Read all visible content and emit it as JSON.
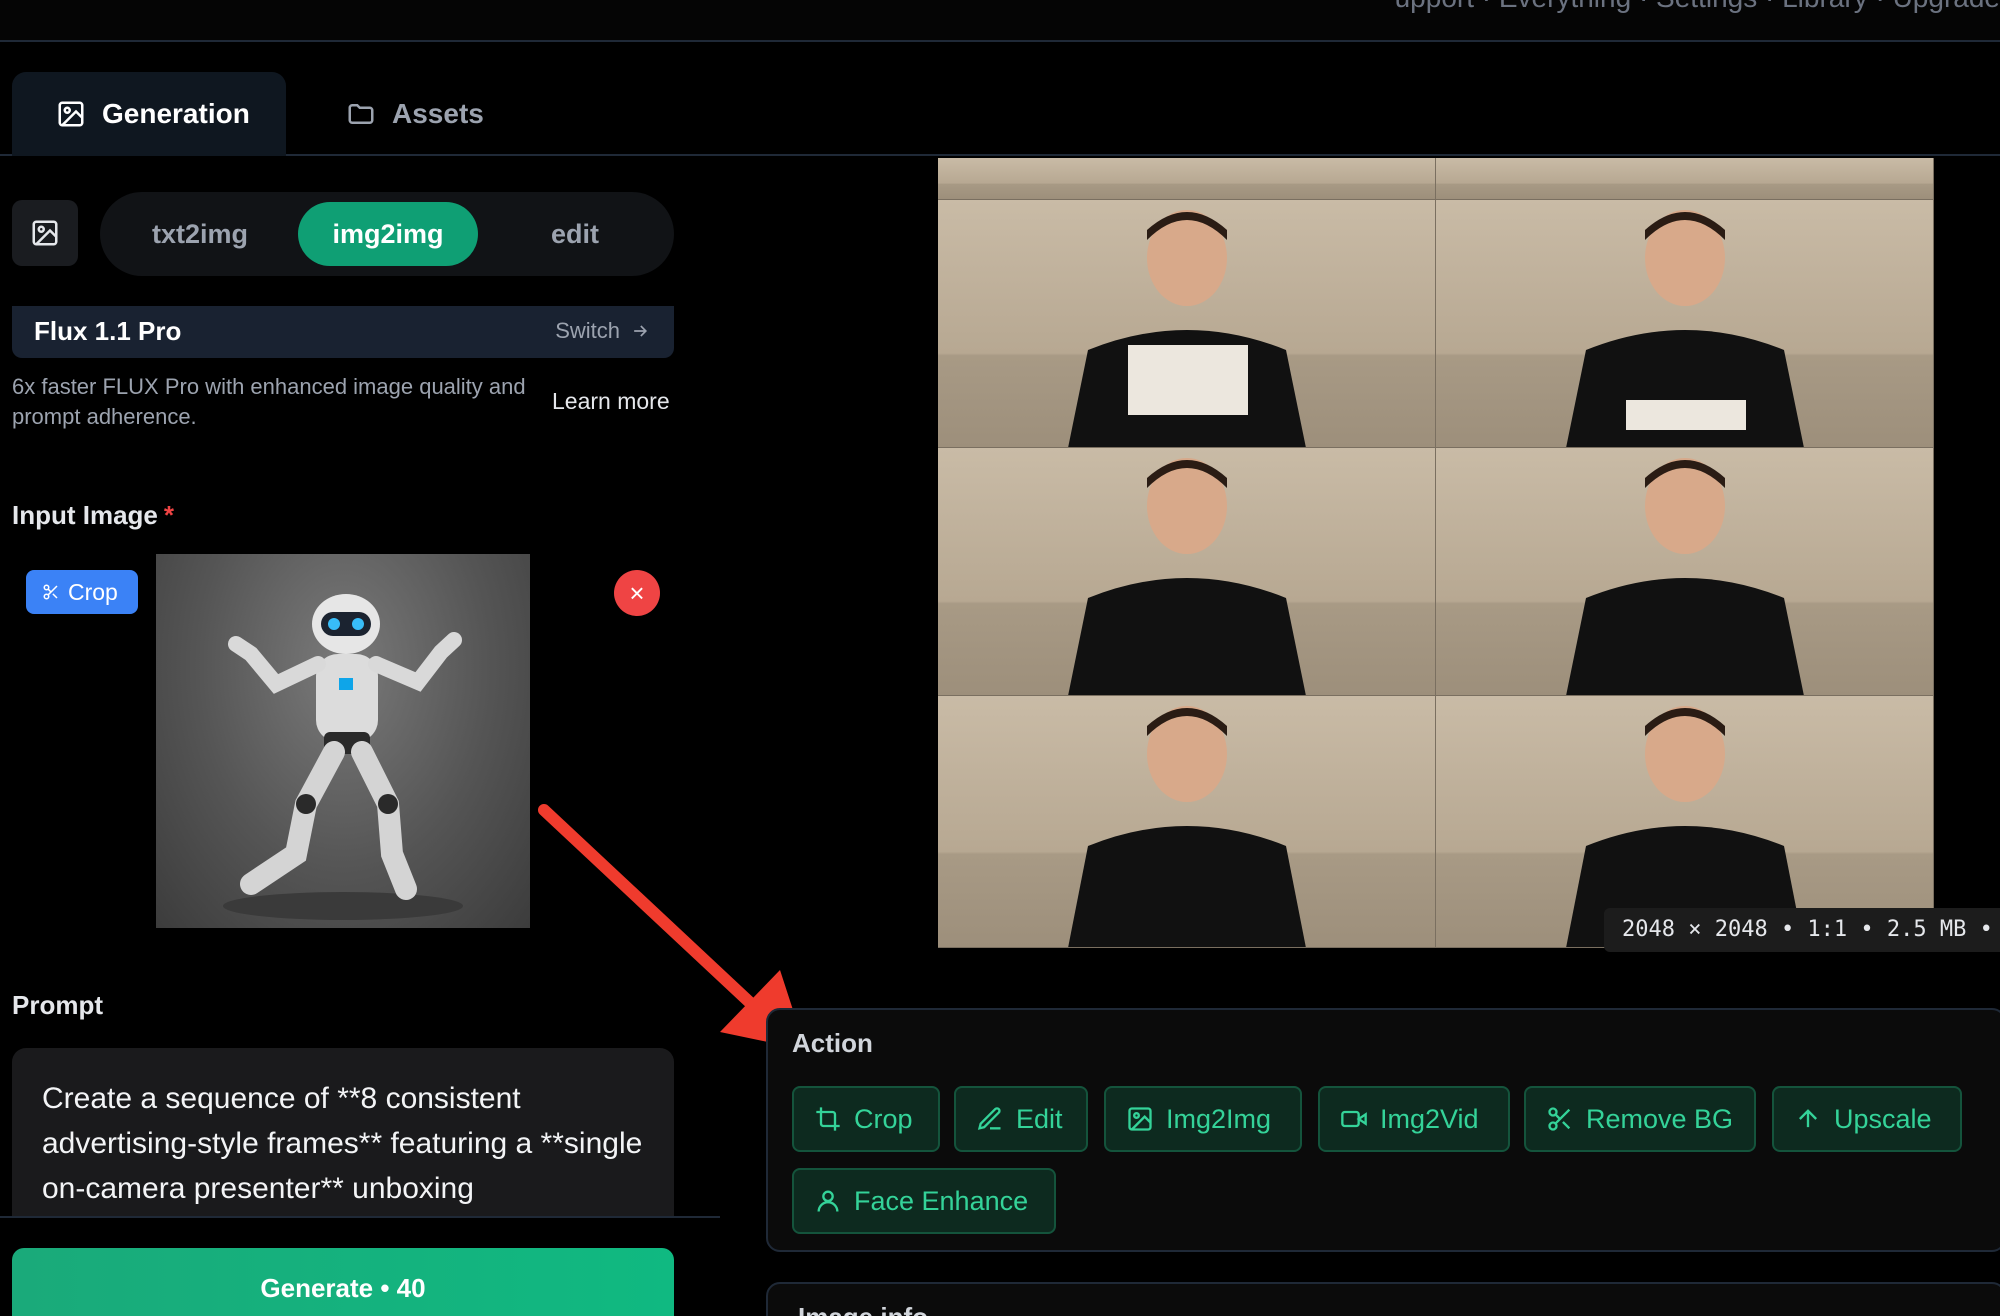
{
  "topbar": {
    "text": "upport · Everything · Settings · Library · Upgrade"
  },
  "tabs": [
    {
      "label": "Generation",
      "icon": "image-icon",
      "active": true
    },
    {
      "label": "Assets",
      "icon": "folder-icon",
      "active": false
    }
  ],
  "modes": {
    "m1": "txt2img",
    "m2": "img2img",
    "m3": "edit",
    "selected": "img2img"
  },
  "model": {
    "name": "Flux 1.1 Pro",
    "switch_label": "Switch",
    "description": "6x faster FLUX Pro with enhanced image quality and prompt adherence.",
    "learn_more": "Learn more"
  },
  "input_image": {
    "label": "Input Image",
    "required_mark": "*",
    "crop_label": "Crop",
    "remove_label": "×"
  },
  "prompt": {
    "label": "Prompt",
    "value": "Create a sequence of **8 consistent advertising-style frames** featuring a **single on-camera presenter** unboxing"
  },
  "generate": {
    "label": "Generate • 40"
  },
  "result": {
    "dims": "2048 × 2048 • 1:1 • 2.5 MB •"
  },
  "actions": {
    "title": "Action",
    "crop": "Crop",
    "edit": "Edit",
    "img2img": "Img2Img",
    "img2vid": "Img2Vid",
    "remove_bg": "Remove BG",
    "upscale": "Upscale",
    "face_enhance": "Face Enhance"
  },
  "image_info": {
    "title": "Image info"
  },
  "colors": {
    "accent": "#0f9f74",
    "action_text": "#34d399",
    "danger": "#ef4444",
    "crop_chip": "#3b82f6"
  }
}
